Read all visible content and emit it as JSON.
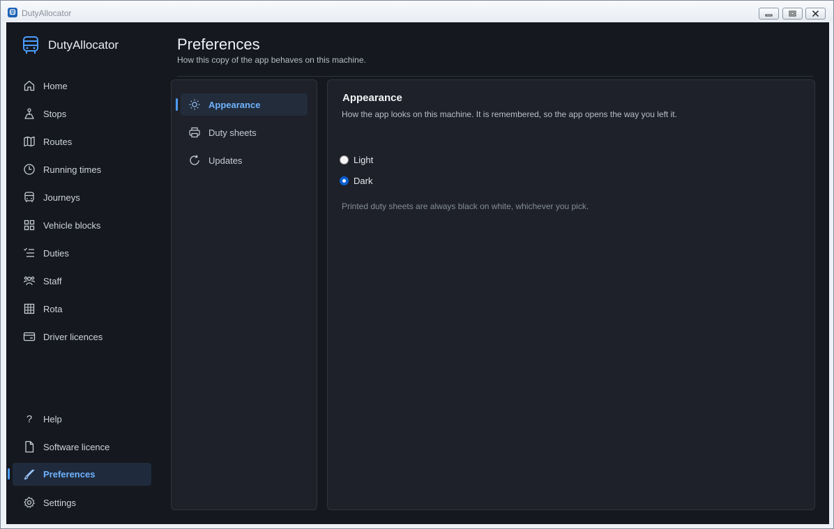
{
  "window": {
    "title": "DutyAllocator"
  },
  "sidebar": {
    "brand": "DutyAllocator",
    "items": [
      {
        "label": "Home",
        "icon": "home-icon"
      },
      {
        "label": "Stops",
        "icon": "stop-icon"
      },
      {
        "label": "Routes",
        "icon": "map-icon"
      },
      {
        "label": "Running times",
        "icon": "clock-icon"
      },
      {
        "label": "Journeys",
        "icon": "bus-icon"
      },
      {
        "label": "Vehicle blocks",
        "icon": "grid-icon"
      },
      {
        "label": "Duties",
        "icon": "checklist-icon"
      },
      {
        "label": "Staff",
        "icon": "people-icon"
      },
      {
        "label": "Rota",
        "icon": "table-icon"
      },
      {
        "label": "Driver licences",
        "icon": "card-icon"
      }
    ],
    "bottom_items": [
      {
        "label": "Help",
        "icon": "question-icon"
      },
      {
        "label": "Software licence",
        "icon": "document-icon"
      },
      {
        "label": "Preferences",
        "icon": "brush-icon",
        "active": true
      },
      {
        "label": "Settings",
        "icon": "gear-icon"
      }
    ]
  },
  "header": {
    "title": "Preferences",
    "subtitle": "How this copy of the app behaves on this machine."
  },
  "subnav": {
    "items": [
      {
        "label": "Appearance",
        "icon": "sun-icon",
        "active": true
      },
      {
        "label": "Duty sheets",
        "icon": "printer-icon"
      },
      {
        "label": "Updates",
        "icon": "refresh-icon"
      }
    ]
  },
  "appearance": {
    "title": "Appearance",
    "description": "How the app looks on this machine. It is remembered, so the app opens the way you left it.",
    "options": [
      {
        "label": "Light",
        "selected": false
      },
      {
        "label": "Dark",
        "selected": true
      }
    ],
    "note": "Printed duty sheets are always black on white, whichever you pick."
  },
  "colors": {
    "accent": "#4c9dff",
    "background": "#15181e",
    "panel": "#1e2129"
  }
}
